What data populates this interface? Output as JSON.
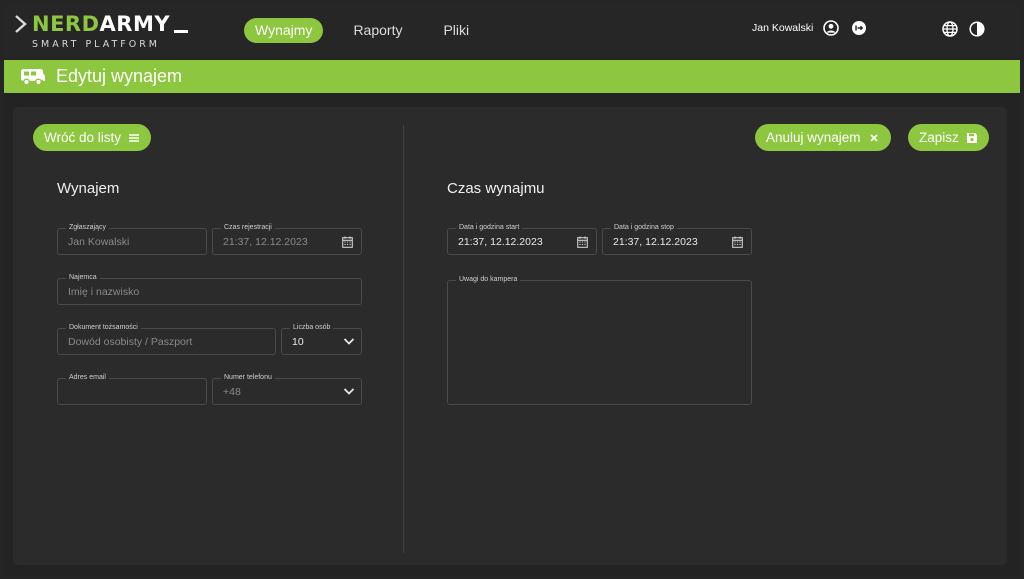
{
  "brand": {
    "name_part1": "NERD",
    "name_part2": "ARMY",
    "tagline": "SMART PLATFORM",
    "accent": "#8dc63f"
  },
  "nav": {
    "items": [
      {
        "label": "Wynajmy",
        "active": true
      },
      {
        "label": "Raporty",
        "active": false
      },
      {
        "label": "Pliki",
        "active": false
      }
    ]
  },
  "user": {
    "name": "Jan Kowalski",
    "icons": [
      "user-circle-icon",
      "logout-icon",
      "globe-icon",
      "contrast-icon"
    ]
  },
  "page": {
    "title": "Edytuj wynajem",
    "icon": "camper-bus-icon"
  },
  "actions": {
    "back": "Wróć do listy",
    "cancel_rental": "Anuluj wynajem",
    "save": "Zapisz"
  },
  "rental_section": {
    "title": "Wynajem",
    "fields": {
      "reporter": {
        "label": "Zgłaszający",
        "value": "Jan Kowalski"
      },
      "reg_time": {
        "label": "Czas rejestracji",
        "value": "21:37, 12.12.2023"
      },
      "tenant": {
        "label": "Najemca",
        "placeholder": "Imię i nazwisko"
      },
      "id_doc": {
        "label": "Dokument tożsamości",
        "placeholder": "Dowód osobisty / Paszport"
      },
      "people_count": {
        "label": "Liczba osób",
        "value": "10"
      },
      "email": {
        "label": "Adres email",
        "value": ""
      },
      "phone": {
        "label": "Numer telefonu",
        "placeholder": "+48"
      }
    }
  },
  "time_section": {
    "title": "Czas wynajmu",
    "fields": {
      "start": {
        "label": "Data i godzina start",
        "value": "21:37, 12.12.2023"
      },
      "stop": {
        "label": "Data i godzina stop",
        "value": "21:37, 12.12.2023"
      },
      "notes": {
        "label": "Uwagi do kampera",
        "value": ""
      }
    }
  }
}
